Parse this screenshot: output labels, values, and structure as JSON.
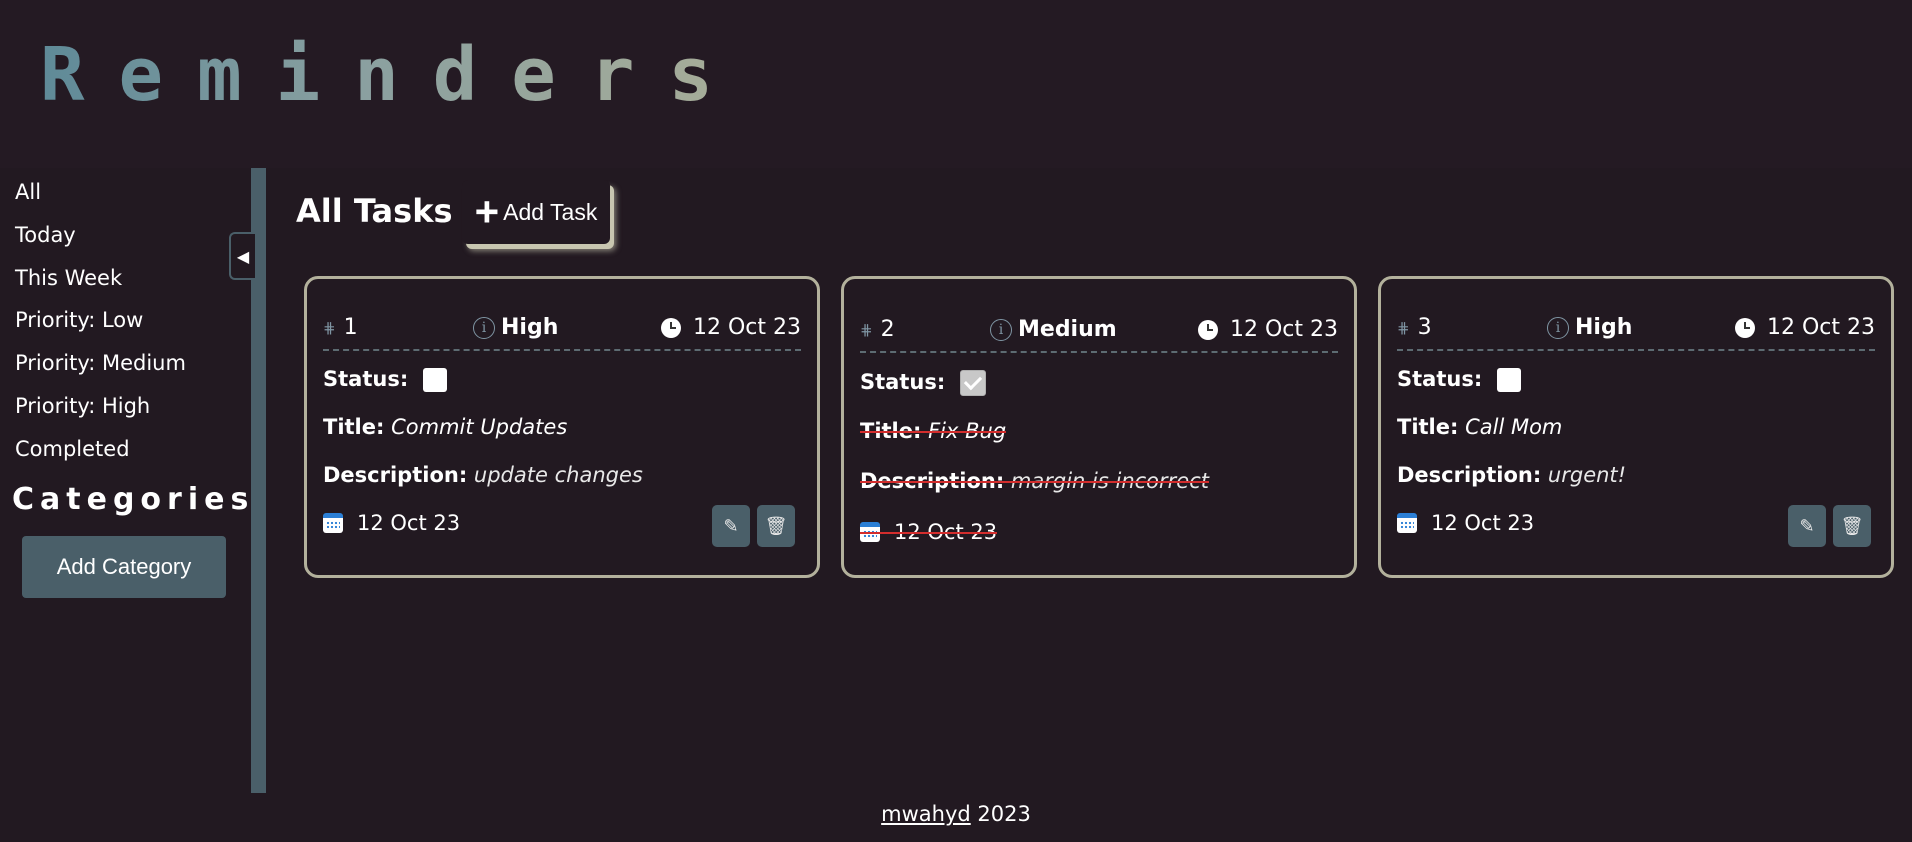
{
  "app": {
    "logo": "Reminders"
  },
  "sidebar": {
    "items": [
      {
        "label": "All"
      },
      {
        "label": "Today"
      },
      {
        "label": "This Week"
      },
      {
        "label": "Priority: Low"
      },
      {
        "label": "Priority: Medium"
      },
      {
        "label": "Priority: High"
      },
      {
        "label": "Completed"
      }
    ],
    "categories_heading": "Categories",
    "add_category_label": "Add Category",
    "collapse_icon": "◀"
  },
  "main": {
    "title": "All Tasks",
    "add_task_label": "Add Task",
    "add_task_icon": "+",
    "cards": [
      {
        "id": "1",
        "priority": "High",
        "created": "12 Oct 23",
        "status_label": "Status:",
        "completed": false,
        "title_label": "Title:",
        "title": "Commit Updates",
        "description_label": "Description:",
        "description": "update changes",
        "due": "12 Oct 23",
        "edit_icon": "pencil-icon",
        "delete_icon": "trash-icon"
      },
      {
        "id": "2",
        "priority": "Medium",
        "created": "12 Oct 23",
        "status_label": "Status:",
        "completed": true,
        "title_label": "Title:",
        "title": "Fix Bug",
        "description_label": "Description:",
        "description": "margin is incorrect",
        "due": "12 Oct 23"
      },
      {
        "id": "3",
        "priority": "High",
        "created": "12 Oct 23",
        "status_label": "Status:",
        "completed": false,
        "title_label": "Title:",
        "title": "Call Mom",
        "description_label": "Description:",
        "description": "urgent!",
        "due": "12 Oct 23",
        "edit_icon": "pencil-icon",
        "delete_icon": "trash-icon"
      }
    ]
  },
  "footer": {
    "author": "mwahyd",
    "year": "2023"
  },
  "colors": {
    "background": "#221921",
    "accent": "#4a5f69",
    "card_border": "#b3b19c",
    "strike": "#d32d2d"
  }
}
